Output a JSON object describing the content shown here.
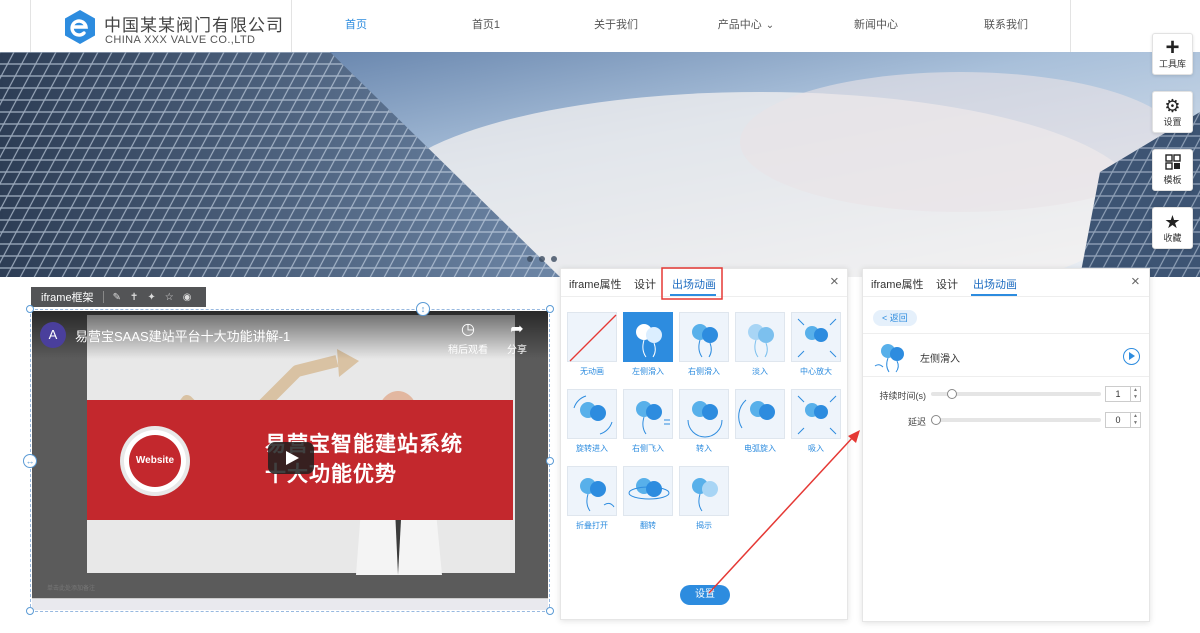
{
  "header": {
    "brand_cn": "中国某某阀门有限公司",
    "brand_en": "CHINA XXX VALVE CO.,LTD",
    "nav": [
      {
        "label": "首页",
        "active": true
      },
      {
        "label": "首页1",
        "active": false
      },
      {
        "label": "关于我们",
        "active": false
      },
      {
        "label": "产品中心",
        "active": false,
        "has_dropdown": true
      },
      {
        "label": "新闻中心",
        "active": false
      },
      {
        "label": "联系我们",
        "active": false
      }
    ]
  },
  "right_toolbar": [
    {
      "label": "工具库",
      "icon": "plus-icon"
    },
    {
      "label": "设置",
      "icon": "gear-icon"
    },
    {
      "label": "模板",
      "icon": "template-icon"
    },
    {
      "label": "收藏",
      "icon": "star-icon"
    }
  ],
  "module_toolbar": {
    "label": "iframe框架"
  },
  "video": {
    "avatar_letter": "A",
    "title": "易营宝SAAS建站平台十大功能讲解-1",
    "watch_later": "稍后观看",
    "share": "分享",
    "slide_badge": "Website",
    "slide_title_line1": "易营宝智能建站系统",
    "slide_title_line2": "十大功能优势",
    "status_text": "单击此处添加备注"
  },
  "panel_left": {
    "tabs": [
      "iframe属性",
      "设计",
      "出场动画"
    ],
    "active_tab": "出场动画",
    "close": "×",
    "animations": [
      {
        "label": "无动画",
        "selected": false
      },
      {
        "label": "左侧滑入",
        "selected": true
      },
      {
        "label": "右侧滑入",
        "selected": false
      },
      {
        "label": "淡入",
        "selected": false
      },
      {
        "label": "中心放大",
        "selected": false
      },
      {
        "label": "旋转进入",
        "selected": false
      },
      {
        "label": "右侧飞入",
        "selected": false
      },
      {
        "label": "转入",
        "selected": false
      },
      {
        "label": "电弧旋入",
        "selected": false
      },
      {
        "label": "吸入",
        "selected": false
      },
      {
        "label": "折叠打开",
        "selected": false
      },
      {
        "label": "翻转",
        "selected": false
      },
      {
        "label": "揭示",
        "selected": false
      }
    ],
    "setup_button": "设置"
  },
  "panel_right": {
    "tabs": [
      "iframe属性",
      "设计",
      "出场动画"
    ],
    "active_tab": "出场动画",
    "close": "×",
    "back_label": "< 返回",
    "selected_animation": "左侧滑入",
    "duration_label": "持续时间(s)",
    "duration_value": "1",
    "delay_label": "延迟",
    "delay_value": "0"
  },
  "colors": {
    "accent": "#2d8cdf",
    "highlight_box": "#e53935",
    "video_red": "#c3282d"
  }
}
